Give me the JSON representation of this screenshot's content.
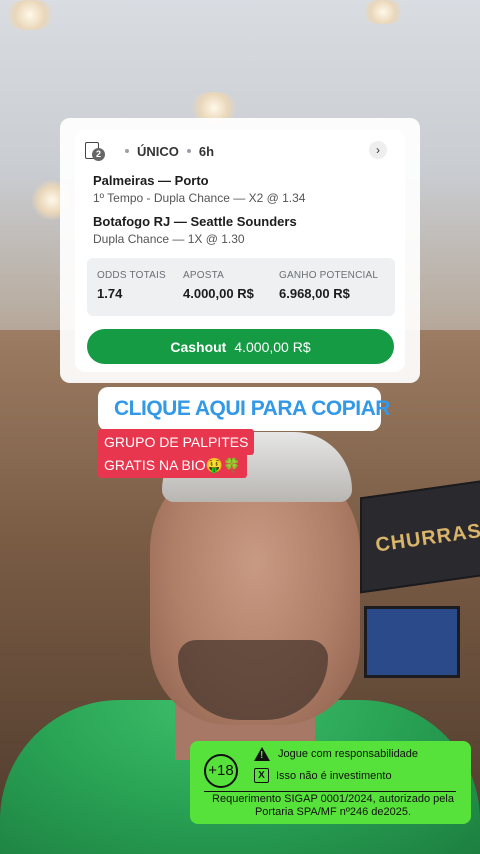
{
  "bet": {
    "count_badge": "2",
    "type": "ÚNICO",
    "time": "6h",
    "legs": [
      {
        "match": "Palmeiras — Porto",
        "market": "1º Tempo - Dupla Chance — X2 @ 1.34"
      },
      {
        "match": "Botafogo RJ — Seattle Sounders",
        "market": "Dupla Chance — 1X @ 1.30"
      }
    ],
    "stats": {
      "odds_label": "ODDS TOTAIS",
      "odds_value": "1.74",
      "stake_label": "APOSTA",
      "stake_value": "4.000,00 R$",
      "potential_label": "GANHO POTENCIAL",
      "potential_value": "6.968,00 R$"
    },
    "cashout_label": "Cashout",
    "cashout_amount": "4.000,00 R$"
  },
  "copy_link": {
    "text": "CLIQUE AQUI PARA COPIAR",
    "icon": "link-icon"
  },
  "caption": {
    "line1": "GRUPO DE PALPITES",
    "line2": "GRATIS NA BIO🤑🍀"
  },
  "disclaimer": {
    "age": "+18",
    "line1": "Jogue com responsabilidade",
    "line2": "Isso não é investimento",
    "legal": "Requerimento SIGAP 0001/2024, autorizado pela Portaria SPA/MF nº246 de2025."
  },
  "background_sign": "CHURRASCO",
  "colors": {
    "cashout": "#169b45",
    "copy_text": "#3399e6",
    "caption_bg": "#e8364f",
    "disclaimer_bg": "#56e23a"
  }
}
